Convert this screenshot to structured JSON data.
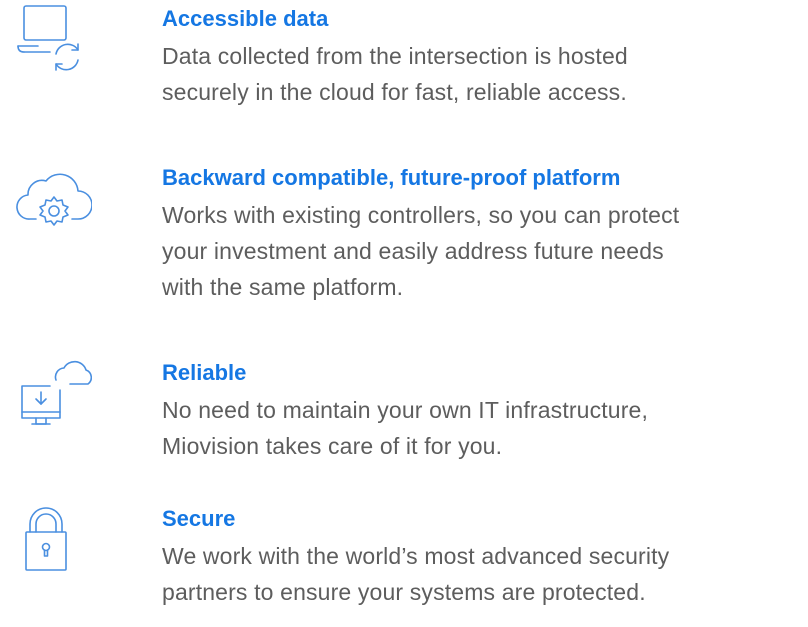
{
  "features": [
    {
      "icon": "laptop-sync-icon",
      "title": "Accessible data",
      "lines": [
        "Data collected from the intersection is hosted",
        "securely in the cloud for fast, reliable access."
      ]
    },
    {
      "icon": "cloud-gear-icon",
      "title": "Backward compatible, future-proof platform",
      "lines": [
        "Works with existing controllers, so you can protect",
        "your investment and easily address future needs",
        "with the same platform."
      ]
    },
    {
      "icon": "cloud-monitor-download-icon",
      "title": "Reliable",
      "lines": [
        "No need to maintain your own IT infrastructure,",
        "Miovision takes care of it for you."
      ]
    },
    {
      "icon": "padlock-icon",
      "title": "Secure",
      "lines": [
        "We work with the world’s most advanced security",
        "partners to ensure your systems are protected."
      ]
    }
  ],
  "colors": {
    "accent": "#1577e3",
    "icon_stroke": "#4a8fe0",
    "body_text": "#5d5d5d"
  }
}
